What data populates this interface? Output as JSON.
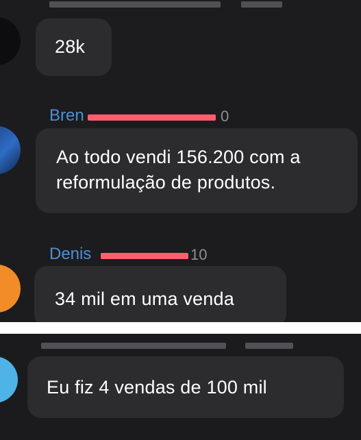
{
  "messages": [
    {
      "text": "28k"
    },
    {
      "sender": "Bren",
      "time_suffix": "0",
      "text": "Ao todo vendi 156.200 com a reformulação de produtos."
    },
    {
      "sender": "Denis",
      "time_suffix": "10",
      "text": "34 mil em uma venda"
    },
    {
      "text": "Eu fiz 4 vendas de 100 mil"
    }
  ],
  "colors": {
    "background": "#1c1c1e",
    "bubble": "#2c2c2e",
    "sender_name": "#4a90d9",
    "redaction": "#ff5f6d",
    "timestamp": "#8e8e93",
    "avatar_orange": "#f28c28",
    "avatar_blue": "#1e4f9a"
  }
}
